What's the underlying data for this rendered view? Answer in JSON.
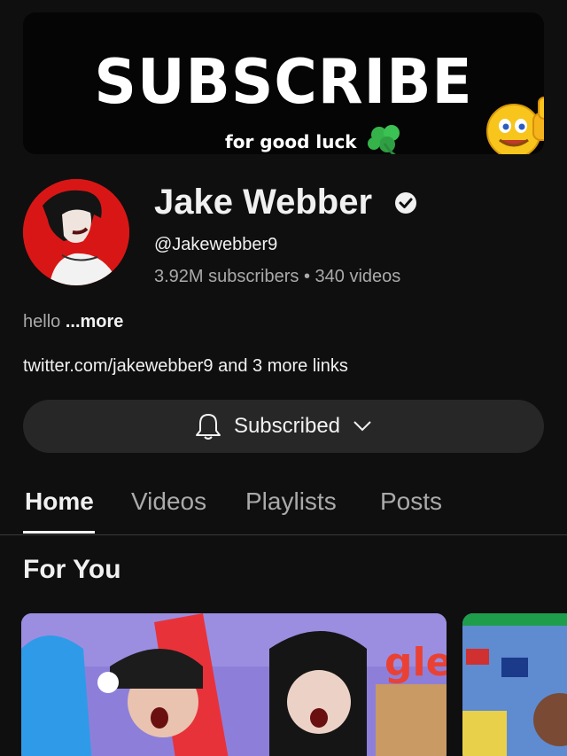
{
  "banner": {
    "title": "SUBSCRIBE",
    "subtitle": "for good luck"
  },
  "channel": {
    "name": "Jake Webber",
    "handle": "@Jakewebber9",
    "subscribers": "3.92M subscribers",
    "separator": "•",
    "videos": "340 videos",
    "description": "hello",
    "more_label": "...more",
    "link_text": "twitter.com/jakewebber9",
    "more_links": "and 3 more links"
  },
  "subscribe_button": {
    "label": "Subscribed"
  },
  "tabs": [
    {
      "label": "Home",
      "active": true
    },
    {
      "label": "Videos",
      "active": false
    },
    {
      "label": "Playlists",
      "active": false
    },
    {
      "label": "Posts",
      "active": false
    }
  ],
  "section": {
    "title": "For You"
  },
  "colors": {
    "background": "#0f0f0f",
    "button_bg": "#272727",
    "secondary_text": "#aaaaaa",
    "avatar_bg": "#d91616"
  },
  "icons": [
    "verified-badge-icon",
    "bell-icon",
    "chevron-down-icon",
    "clover-icon",
    "thumbs-up-emoji-icon"
  ]
}
